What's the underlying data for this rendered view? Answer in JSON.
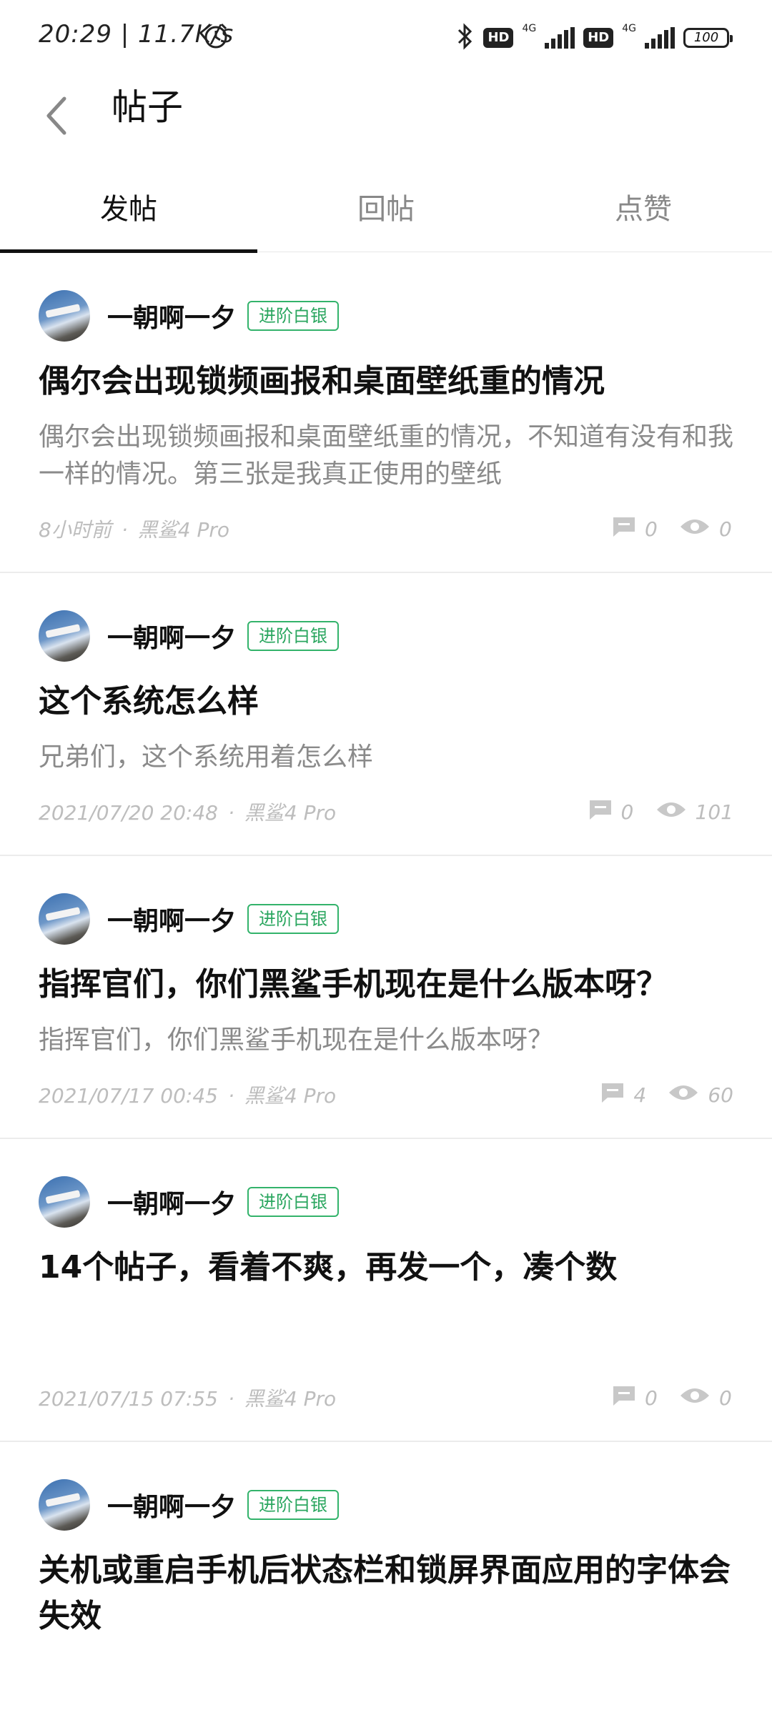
{
  "status_bar": {
    "time_speed": "20:29 | 11.7K/s",
    "battery": "100",
    "net_label_1": "4G",
    "net_label_2": "4G",
    "hd_1": "HD",
    "hd_2": "HD"
  },
  "header": {
    "title": "帖子"
  },
  "tabs": [
    {
      "label": "发帖",
      "active": true
    },
    {
      "label": "回帖",
      "active": false
    },
    {
      "label": "点赞",
      "active": false
    }
  ],
  "posts": [
    {
      "username": "一朝啊一夕",
      "badge": "进阶白银",
      "title": "偶尔会出现锁频画报和桌面壁纸重的情况",
      "body": "偶尔会出现锁频画报和桌面壁纸重的情况，不知道有没有和我一样的情况。第三张是我真正使用的壁纸",
      "time": "8小时前",
      "device": "黑鲨4 Pro",
      "comments": "0",
      "views": "0"
    },
    {
      "username": "一朝啊一夕",
      "badge": "进阶白银",
      "title": "这个系统怎么样",
      "body": "兄弟们，这个系统用着怎么样",
      "time": "2021/07/20 20:48",
      "device": "黑鲨4 Pro",
      "comments": "0",
      "views": "101"
    },
    {
      "username": "一朝啊一夕",
      "badge": "进阶白银",
      "title": "指挥官们，你们黑鲨手机现在是什么版本呀？",
      "body": "指挥官们，你们黑鲨手机现在是什么版本呀？",
      "time": "2021/07/17 00:45",
      "device": "黑鲨4 Pro",
      "comments": "4",
      "views": "60"
    },
    {
      "username": "一朝啊一夕",
      "badge": "进阶白银",
      "title": "14个帖子，看着不爽，再发一个，凑个数",
      "body": "",
      "time": "2021/07/15 07:55",
      "device": "黑鲨4 Pro",
      "comments": "0",
      "views": "0"
    },
    {
      "username": "一朝啊一夕",
      "badge": "进阶白银",
      "title": "关机或重启手机后状态栏和锁屏界面应用的字体会失效",
      "body": "",
      "time": "",
      "device": "",
      "comments": "",
      "views": ""
    }
  ],
  "colors": {
    "accent_badge": "#2aa65f",
    "meta_gray": "#bdbdbd",
    "body_gray": "#8a8a8a",
    "tab_inactive": "#888888",
    "divider": "#ececec"
  },
  "separator": "·"
}
